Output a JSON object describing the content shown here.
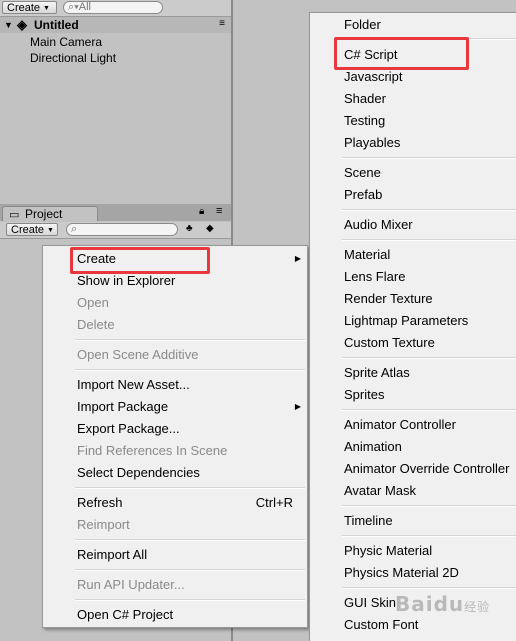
{
  "hierarchy": {
    "create_label": "Create",
    "search_placeholder": "All",
    "scene_name": "Untitled",
    "items": [
      "Main Camera",
      "Directional Light"
    ]
  },
  "project": {
    "tab_label": "Project",
    "create_label": "Create"
  },
  "context_menu": {
    "items": [
      {
        "label": "Create",
        "state": "submenu"
      },
      {
        "label": "Show in Explorer"
      },
      {
        "label": "Open",
        "state": "disabled"
      },
      {
        "label": "Delete",
        "state": "disabled"
      },
      {
        "label": "Open Scene Additive",
        "state": "disabled"
      },
      {
        "label": "Import New Asset..."
      },
      {
        "label": "Import Package",
        "state": "submenu"
      },
      {
        "label": "Export Package..."
      },
      {
        "label": "Find References In Scene",
        "state": "disabled"
      },
      {
        "label": "Select Dependencies"
      },
      {
        "label": "Refresh",
        "shortcut": "Ctrl+R"
      },
      {
        "label": "Reimport",
        "state": "disabled"
      },
      {
        "label": "Reimport All"
      },
      {
        "label": "Run API Updater...",
        "state": "disabled"
      },
      {
        "label": "Open C# Project"
      }
    ]
  },
  "create_submenu": {
    "items": [
      "Folder",
      "C# Script",
      "Javascript",
      "Shader",
      "Testing",
      "Playables",
      "Scene",
      "Prefab",
      "Audio Mixer",
      "Material",
      "Lens Flare",
      "Render Texture",
      "Lightmap Parameters",
      "Custom Texture",
      "Sprite Atlas",
      "Sprites",
      "Animator Controller",
      "Animation",
      "Animator Override Controller",
      "Avatar Mask",
      "Timeline",
      "Physic Material",
      "Physics Material 2D",
      "GUI Skin",
      "Custom Font"
    ]
  },
  "colors": {
    "highlight_box": "#e8383d",
    "menu_bg": "#f0f0f0",
    "panel_bg": "#c2c2c2"
  },
  "watermark": {
    "text": "Baidu",
    "sub": "经验"
  }
}
